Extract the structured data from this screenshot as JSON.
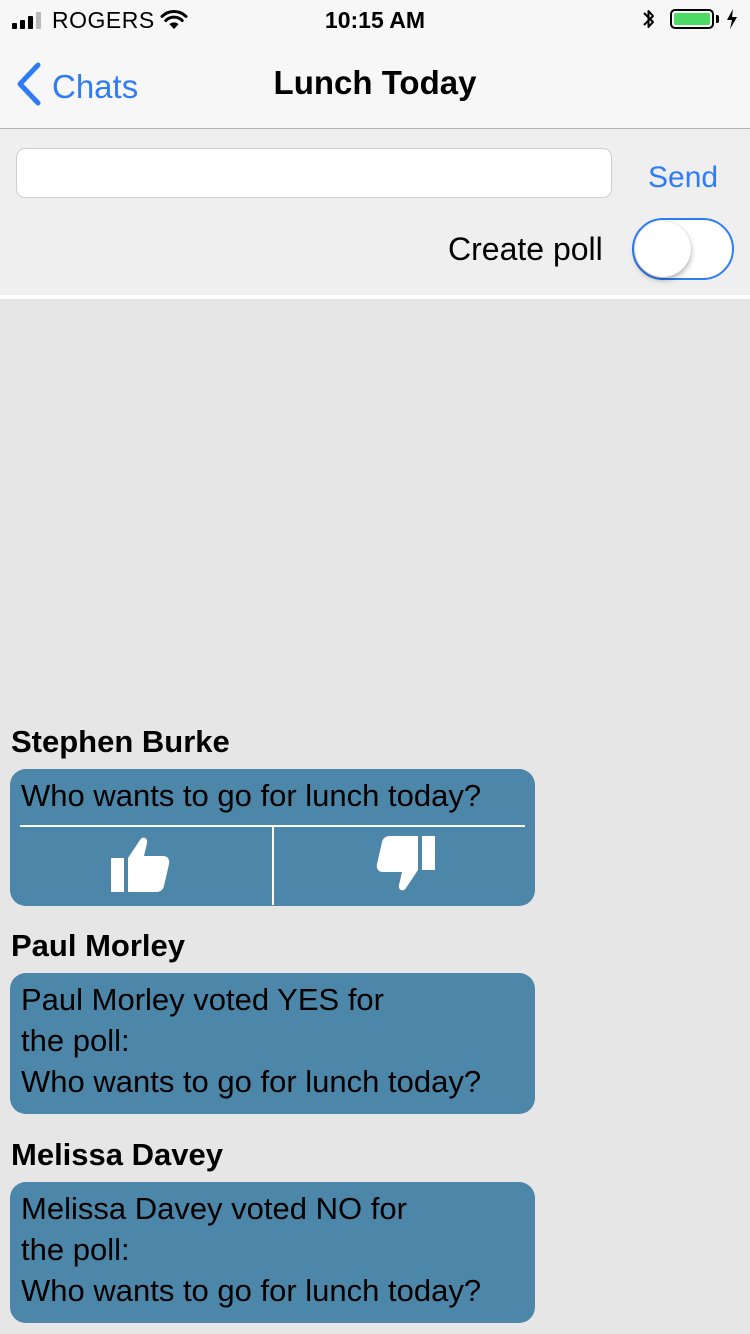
{
  "status_bar": {
    "carrier": "ROGERS",
    "time": "10:15 AM",
    "signal_bars_filled": 3,
    "signal_bars_total": 4,
    "battery_level": 1.0,
    "charging": true
  },
  "nav": {
    "back_label": "Chats",
    "title": "Lunch Today"
  },
  "compose": {
    "input_value": "",
    "input_placeholder": "",
    "send_label": "Send",
    "poll_label": "Create poll",
    "poll_toggle_on": false
  },
  "messages": [
    {
      "sender": "Stephen Burke",
      "text": "Who wants to go for lunch today?"
    },
    {
      "sender": "Paul Morley",
      "text": "Paul Morley voted YES for\nthe poll:\nWho wants to go for lunch today?"
    },
    {
      "sender": "Melissa Davey",
      "text": "Melissa Davey voted NO for\nthe poll:\nWho wants to go for lunch today?"
    }
  ],
  "colors": {
    "accent": "#2f7cf6",
    "bubble": "#4c86a8",
    "background": "#e6e6e6",
    "battery": "#4cd964"
  },
  "icons": [
    "signal-icon",
    "wifi-icon",
    "bluetooth-icon",
    "battery-icon",
    "charging-icon",
    "chevron-left-icon",
    "thumbs-up-icon",
    "thumbs-down-icon"
  ]
}
